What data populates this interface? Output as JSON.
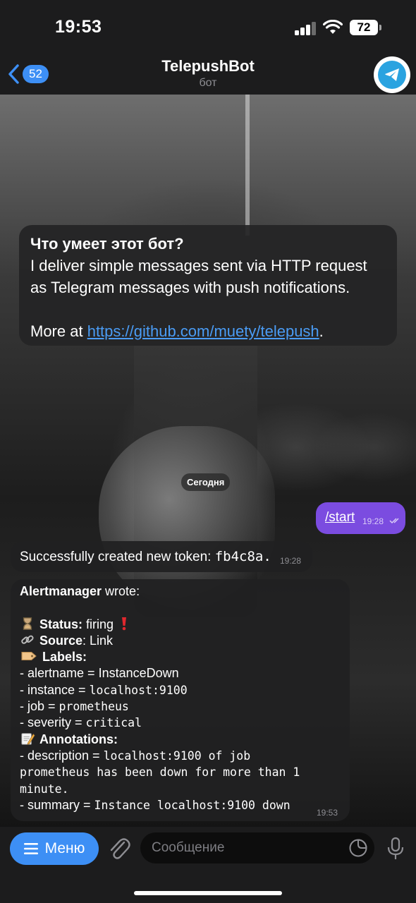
{
  "status_bar": {
    "time": "19:53",
    "battery": "72"
  },
  "header": {
    "back_count": "52",
    "title": "TelepushBot",
    "subtitle": "бот"
  },
  "info": {
    "title": "Что умеет этот бот?",
    "line1": "I deliver simple messages sent via HTTP request",
    "line2": "as Telegram messages with push notifications.",
    "more_prefix": "More at ",
    "link": "https://github.com/muety/telepush",
    "more_suffix": "."
  },
  "date_chip": "Сегодня",
  "outgoing": {
    "text": "/start",
    "time": "19:28"
  },
  "token_msg": {
    "prefix": "Successfully created new token: ",
    "token": "fb4c8a.",
    "time": "19:28"
  },
  "alert": {
    "sender": "Alertmanager",
    "wrote": " wrote:",
    "status_label": "Status:",
    "status_value": " firing",
    "source_label": "Source",
    "source_value": ": Link",
    "labels_label": "Labels:",
    "label_lines": [
      {
        "key": "- alertname = ",
        "value": "InstanceDown"
      },
      {
        "key": "- instance = ",
        "value": "localhost:9100"
      },
      {
        "key": "- job = ",
        "value": "prometheus"
      },
      {
        "key": "- severity = ",
        "value": "critical"
      }
    ],
    "annotations_label": "Annotations:",
    "desc_key": "- description = ",
    "desc_line1": "localhost:9100 of job",
    "desc_line2": "prometheus has been down for more than 1",
    "desc_line3": "minute.",
    "summary_key": "- summary = ",
    "summary_value": "Instance localhost:9100 down",
    "time": "19:53"
  },
  "composer": {
    "menu_label": "Меню",
    "placeholder": "Сообщение"
  },
  "colors": {
    "accent": "#3d8ff5",
    "outgoing_bubble": "#7b4ce0",
    "link": "#4a9cf5"
  }
}
